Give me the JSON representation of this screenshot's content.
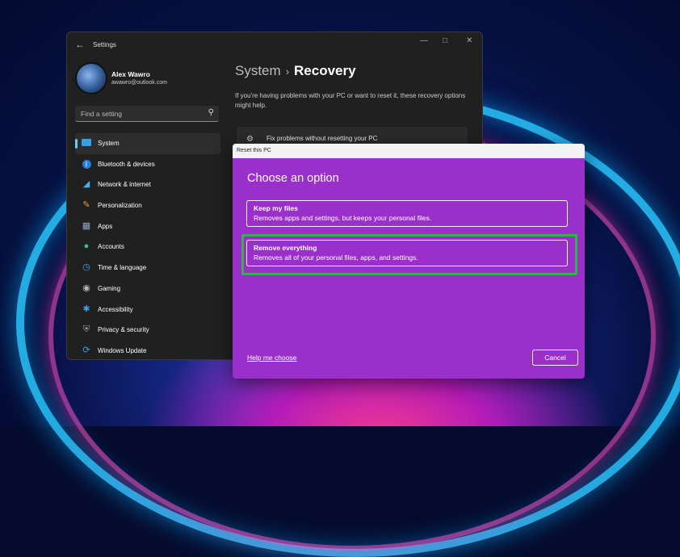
{
  "settings": {
    "app_title": "Settings",
    "user": {
      "name": "Alex Wawro",
      "email": "awawro@outlook.com"
    },
    "search": {
      "placeholder": "Find a setting"
    },
    "nav": [
      {
        "label": "System",
        "icon": "monitor-icon",
        "active": true
      },
      {
        "label": "Bluetooth & devices",
        "icon": "bluetooth-icon"
      },
      {
        "label": "Network & internet",
        "icon": "wifi-icon"
      },
      {
        "label": "Personalization",
        "icon": "brush-icon"
      },
      {
        "label": "Apps",
        "icon": "apps-icon"
      },
      {
        "label": "Accounts",
        "icon": "person-icon"
      },
      {
        "label": "Time & language",
        "icon": "globe-clock-icon"
      },
      {
        "label": "Gaming",
        "icon": "gamepad-icon"
      },
      {
        "label": "Accessibility",
        "icon": "accessibility-icon"
      },
      {
        "label": "Privacy & security",
        "icon": "shield-icon"
      },
      {
        "label": "Windows Update",
        "icon": "update-icon"
      }
    ],
    "breadcrumb": {
      "parent": "System",
      "current": "Recovery"
    },
    "description": "If you're having problems with your PC or want to reset it, these recovery options might help.",
    "card": {
      "title": "Fix problems without resetting your PC"
    }
  },
  "dialog": {
    "title": "Reset this PC",
    "heading": "Choose an option",
    "options": [
      {
        "title": "Keep my files",
        "subtitle": "Removes apps and settings, but keeps your personal files."
      },
      {
        "title": "Remove everything",
        "subtitle": "Removes all of your personal files, apps, and settings."
      }
    ],
    "help_link": "Help me choose",
    "cancel_label": "Cancel"
  },
  "colors": {
    "dialog_bg": "#9a2fc9",
    "highlight": "#2fb54a",
    "accent": "#60cdff",
    "window_bg": "#202020"
  }
}
